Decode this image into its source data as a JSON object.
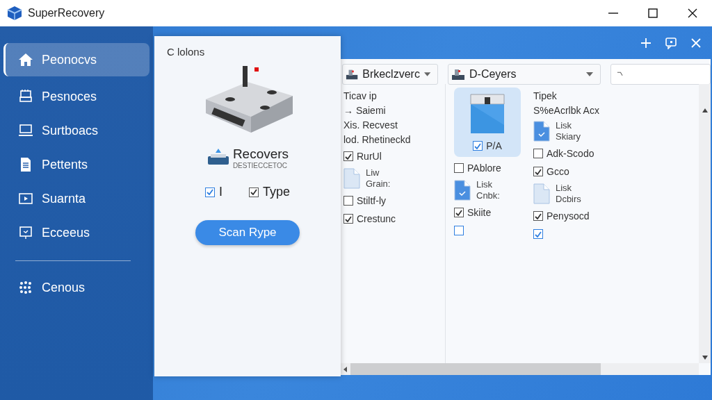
{
  "window": {
    "title": "SuperRecovery"
  },
  "sidebar": {
    "items": [
      {
        "label": "Peonocvs",
        "selected": true
      },
      {
        "label": "Pesnoces",
        "selected": false
      },
      {
        "label": "Surtboacs",
        "selected": false
      },
      {
        "label": "Pettents",
        "selected": false
      },
      {
        "label": "Suarnta",
        "selected": false
      },
      {
        "label": "Ecceeus",
        "selected": false
      }
    ],
    "footer_items": [
      {
        "label": "Cenous",
        "selected": false
      }
    ]
  },
  "options_panel": {
    "title": "C lolons",
    "heading": "Recovers",
    "subheading": "DESTIECCETOC",
    "checkboxes": [
      {
        "label": "I",
        "checked": true
      },
      {
        "label": "Type",
        "checked": true
      }
    ],
    "button": "Scan Rype"
  },
  "file_panel": {
    "dropdowns": [
      {
        "value": "Brkeclzverc"
      },
      {
        "value": "D-Ceyers"
      }
    ],
    "columns": [
      {
        "items": [
          {
            "kind": "text",
            "label": "Ticav ip"
          },
          {
            "kind": "text",
            "label": "→ Saiemi"
          },
          {
            "kind": "text",
            "label": "Xis. Recvest"
          },
          {
            "kind": "text",
            "label": "lod. Rhetineckd"
          },
          {
            "kind": "checkbox",
            "label": "RurUl",
            "checked": true
          },
          {
            "kind": "file",
            "lines": [
              "Liw",
              "Grain:"
            ]
          },
          {
            "kind": "checkbox",
            "label": "Stiltf-ly",
            "checked": false
          },
          {
            "kind": "checkbox",
            "label": "Crestunc",
            "checked": true
          }
        ]
      },
      {
        "items": [
          {
            "kind": "tile",
            "label": "P/A",
            "checked": true,
            "selected": true
          },
          {
            "kind": "checkbox",
            "label": "PAblore",
            "checked": false
          },
          {
            "kind": "file",
            "lines": [
              "Lisk",
              "Cnbk:"
            ]
          },
          {
            "kind": "checkbox",
            "label": "Skiite",
            "checked": true
          },
          {
            "kind": "checkbox",
            "checked": false
          }
        ]
      },
      {
        "items": [
          {
            "kind": "text",
            "label": "Tipek"
          },
          {
            "kind": "text",
            "label": "S%eAcrlbk Acx"
          },
          {
            "kind": "file",
            "lines": [
              "Lisk",
              "Skiary"
            ]
          },
          {
            "kind": "checkbox",
            "label": "Adk-Scodo",
            "checked": false
          },
          {
            "kind": "checkbox",
            "label": "Gcco",
            "checked": true
          },
          {
            "kind": "file",
            "lines": [
              "Lisk",
              "Dcbirs"
            ]
          },
          {
            "kind": "checkbox",
            "label": "Penysocd",
            "checked": true
          },
          {
            "kind": "checkbox",
            "checked": true
          }
        ]
      }
    ]
  }
}
